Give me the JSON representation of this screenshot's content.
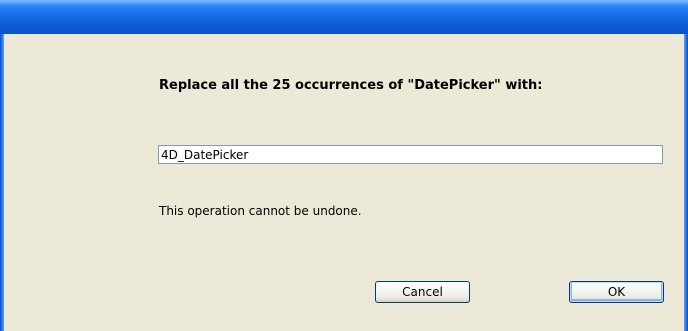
{
  "dialog": {
    "message": "Replace all the 25 occurrences of \"DatePicker\" with:",
    "replacement_value": "4D_DatePicker",
    "warning": "This operation cannot be undone.",
    "cancel_label": "Cancel",
    "ok_label": "OK"
  },
  "colors": {
    "titlebar": "#0a5ad6",
    "dialog_background": "#ece9d8",
    "field_border": "#7f9db9",
    "button_border": "#003c74"
  }
}
